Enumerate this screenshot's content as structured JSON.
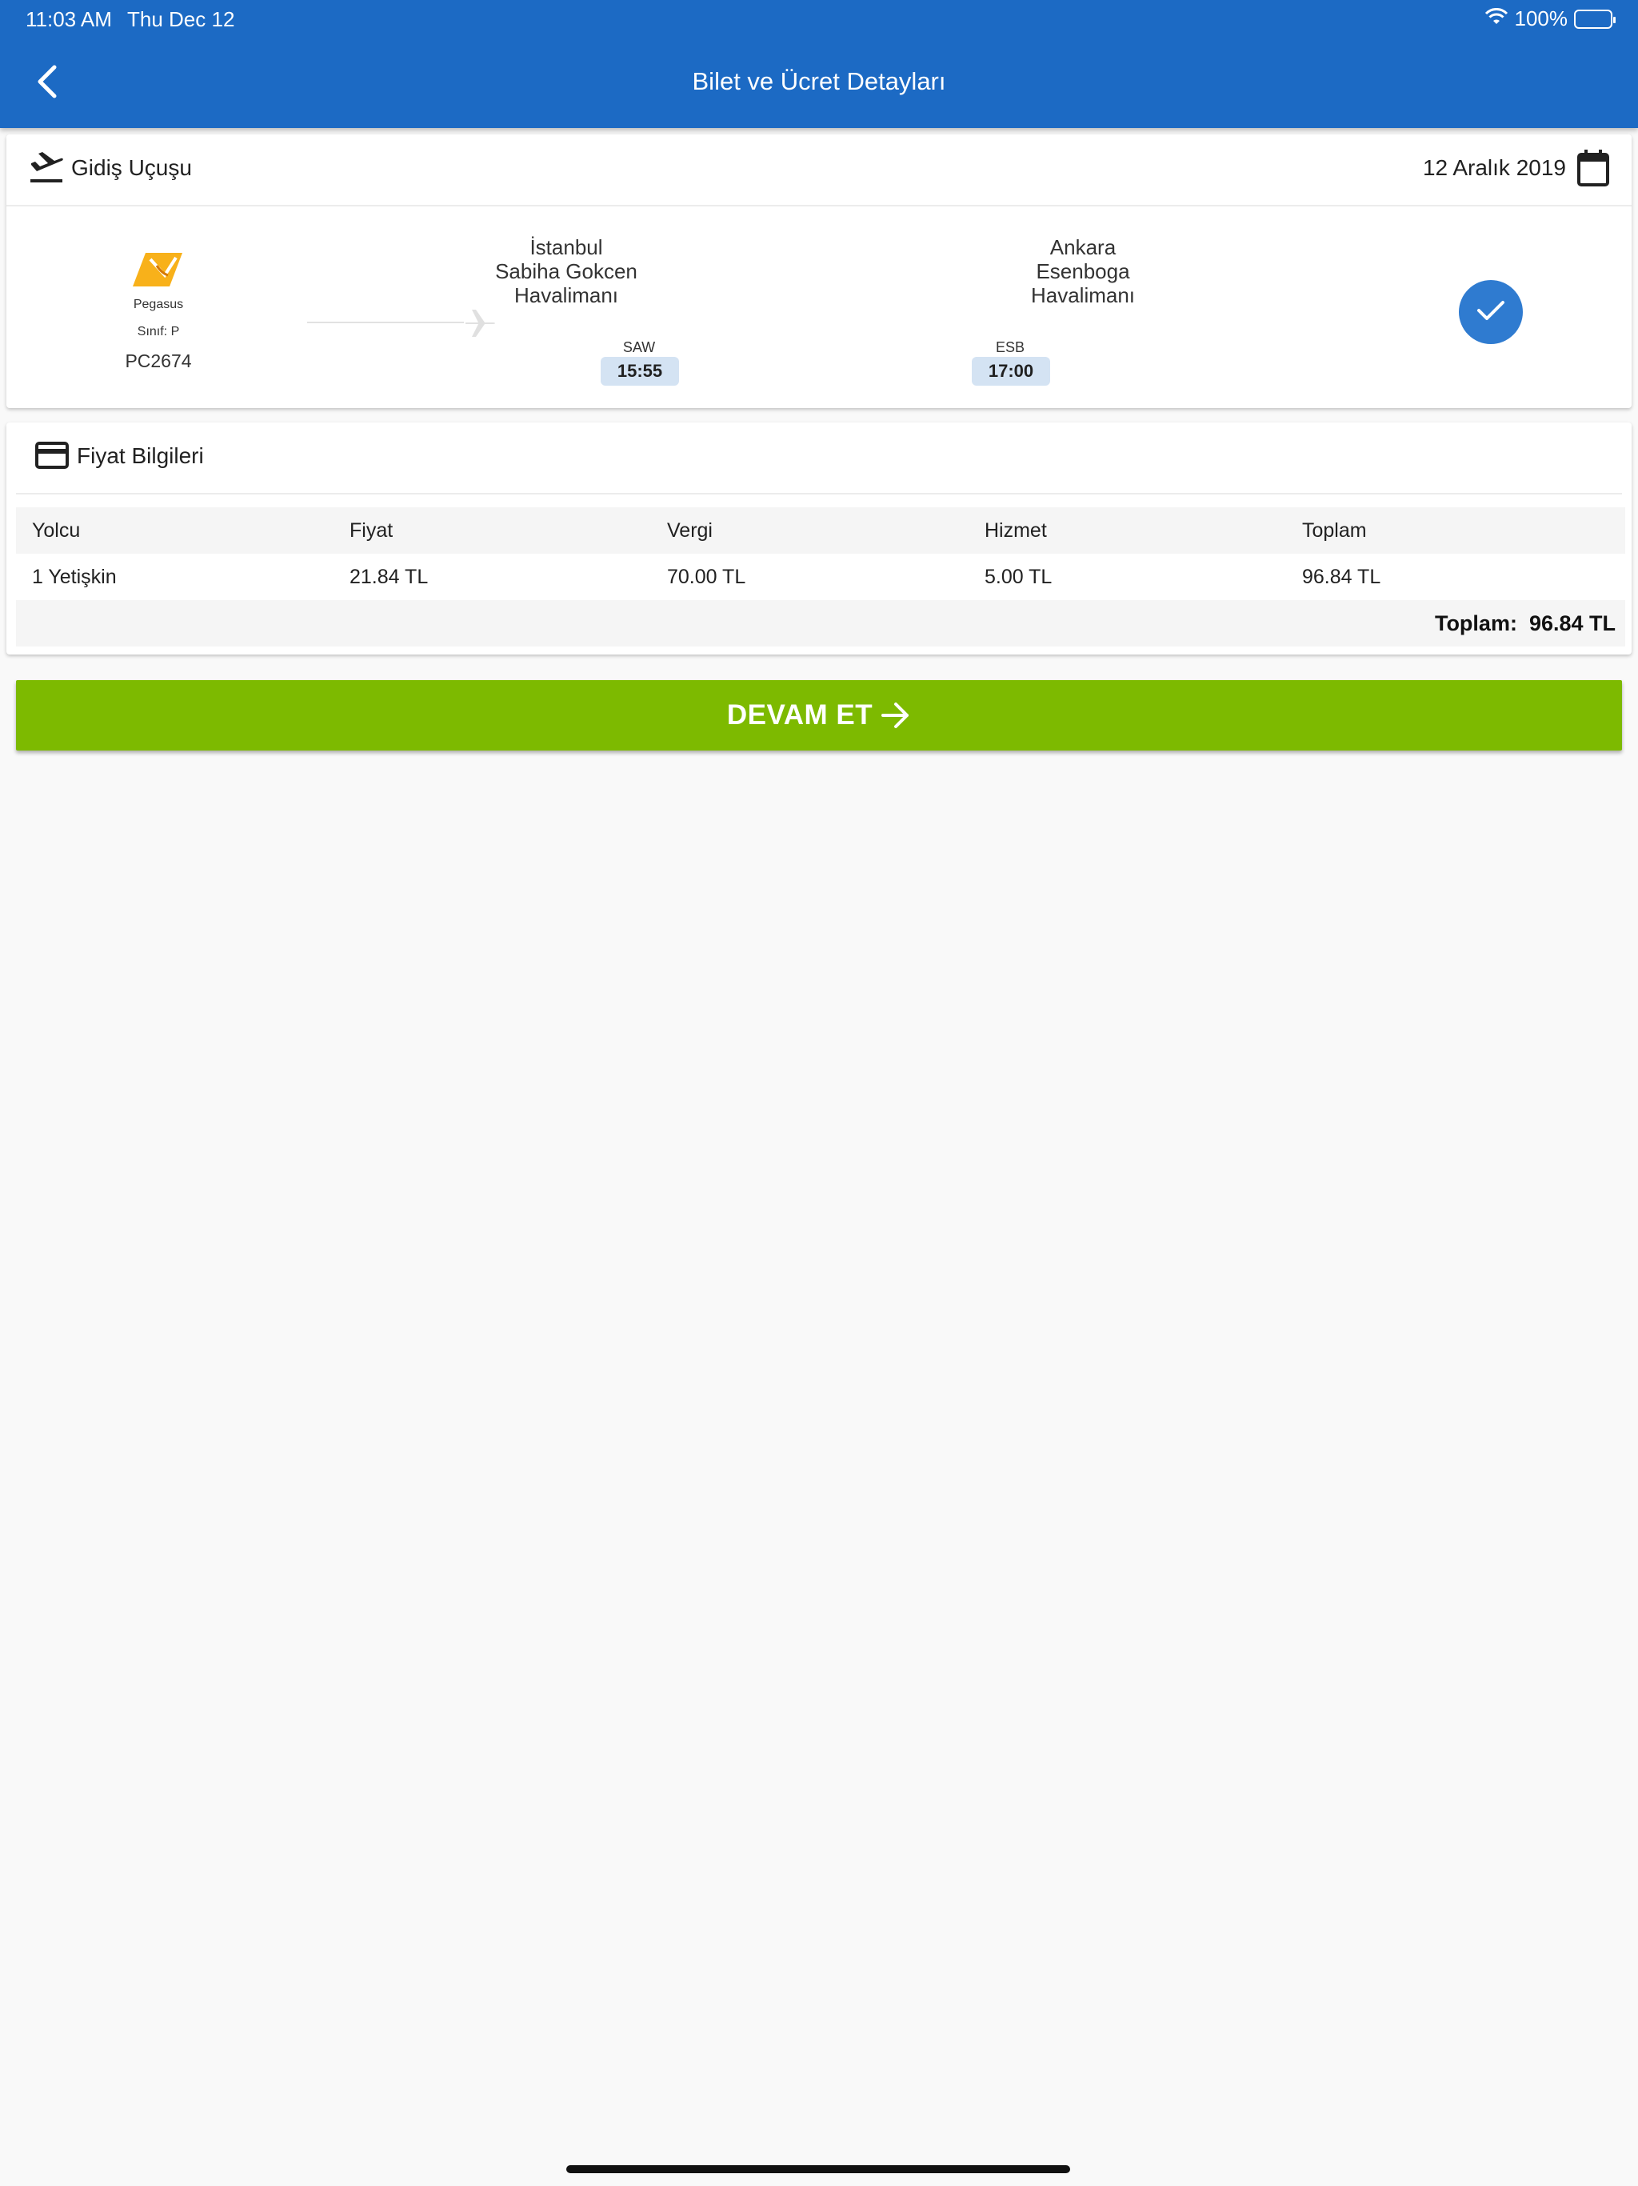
{
  "status_bar": {
    "time": "11:03 AM",
    "date": "Thu Dec 12",
    "battery": "100%"
  },
  "header": {
    "title": "Bilet ve Ücret Detayları"
  },
  "flight": {
    "section_label": "Gidiş Uçuşu",
    "date": "12 Aralık 2019",
    "airline_name": "Pegasus",
    "class_label": "Sınıf: P",
    "flight_number": "PC2674",
    "departure": {
      "city_line1": "İstanbul",
      "city_line2": "Sabiha Gokcen",
      "city_line3": "Havalimanı",
      "code": "SAW",
      "time": "15:55"
    },
    "arrival": {
      "city_line1": "Ankara",
      "city_line2": "Esenboga",
      "city_line3": "Havalimanı",
      "code": "ESB",
      "time": "17:00"
    }
  },
  "price": {
    "section_label": "Fiyat Bilgileri",
    "columns": [
      "Yolcu",
      "Fiyat",
      "Vergi",
      "Hizmet",
      "Toplam"
    ],
    "rows": [
      [
        "1 Yetişkin",
        "21.84 TL",
        "70.00 TL",
        "5.00 TL",
        "96.84 TL"
      ]
    ],
    "total_text": "Toplam:  96.84 TL"
  },
  "continue_button": {
    "label": "DEVAM ET"
  },
  "colors": {
    "primary": "#1c6ac4",
    "accent_green": "#7dba00",
    "check_blue": "#2f7bd0",
    "time_pill": "#d4e3f3"
  }
}
